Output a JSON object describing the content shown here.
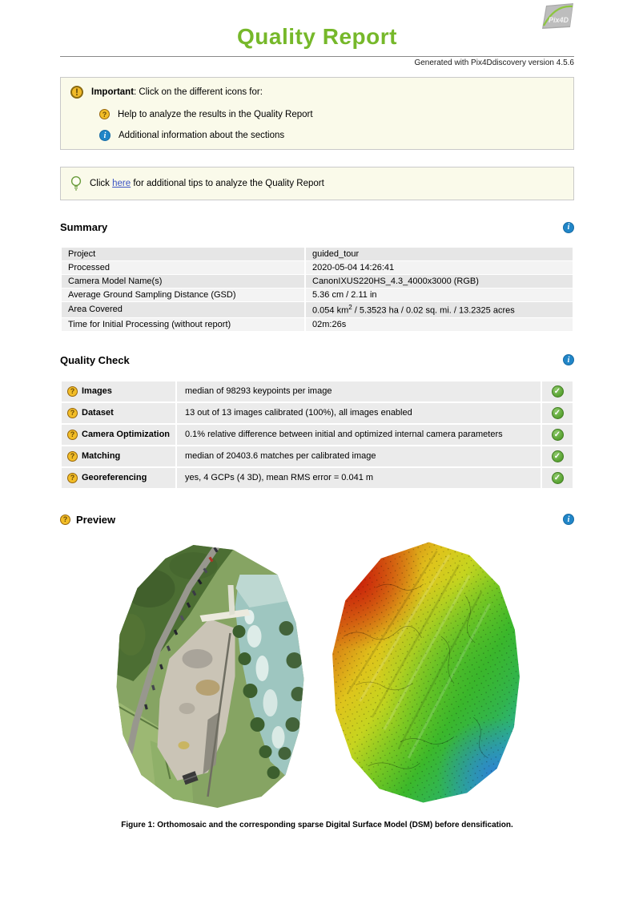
{
  "colors": {
    "accent_green": "#76b82a",
    "info_blue": "#2186c8",
    "warning_gold": "#f0b929",
    "check_green": "#55a02e",
    "link_blue": "#3a53c4",
    "box_background": "#fafaea",
    "table_row_dark": "#e6e6e6",
    "table_row_light": "#f3f3f3",
    "quality_cell": "#ebebeb"
  },
  "icons": {
    "warning_glyph": "!",
    "question_glyph": "?",
    "info_glyph": "i",
    "check_glyph": "✓"
  },
  "header": {
    "title": "Quality Report",
    "generated_line": "Generated with Pix4Ddiscovery version 4.5.6",
    "logo_text": "Pix4D"
  },
  "important_box": {
    "title": "Important",
    "intro_rest": ": Click on the different icons for:",
    "items": [
      {
        "icon": "question-icon",
        "text": "Help to analyze the results in the Quality Report"
      },
      {
        "icon": "info-icon",
        "text": "Additional information about the sections"
      }
    ]
  },
  "tip_box": {
    "before_link": "Click ",
    "link_text": "here",
    "after_link": " for additional tips to analyze the Quality Report"
  },
  "summary": {
    "heading": "Summary",
    "rows": [
      {
        "label": "Project",
        "value": "guided_tour"
      },
      {
        "label": "Processed",
        "value": "2020-05-04 14:26:41"
      },
      {
        "label": "Camera Model Name(s)",
        "value": "CanonIXUS220HS_4.3_4000x3000 (RGB)"
      },
      {
        "label": "Average Ground Sampling Distance (GSD)",
        "value": "5.36 cm / 2.11 in"
      },
      {
        "label": "Area Covered",
        "value_pre": "0.054 km",
        "value_sup": "2",
        "value_post": " / 5.3523 ha / 0.02 sq. mi. / 13.2325 acres"
      },
      {
        "label": "Time for Initial Processing (without report)",
        "value": "02m:26s"
      }
    ]
  },
  "quality_check": {
    "heading": "Quality Check",
    "rows": [
      {
        "label": "Images",
        "description": "median of 98293 keypoints per image",
        "status": "ok"
      },
      {
        "label": "Dataset",
        "description": "13 out of 13 images calibrated (100%), all images enabled",
        "status": "ok"
      },
      {
        "label": "Camera Optimization",
        "description": "0.1% relative difference between initial and optimized internal camera parameters",
        "status": "ok"
      },
      {
        "label": "Matching",
        "description": "median of 20403.6 matches per calibrated image",
        "status": "ok"
      },
      {
        "label": "Georeferencing",
        "description": "yes, 4 GCPs (4 3D), mean RMS error = 0.041 m",
        "status": "ok"
      }
    ]
  },
  "preview": {
    "heading": "Preview",
    "caption": "Figure 1: Orthomosaic and the corresponding sparse Digital Surface Model (DSM) before densification.",
    "images": [
      {
        "name": "orthomosaic"
      },
      {
        "name": "sparse-dsm"
      }
    ]
  }
}
